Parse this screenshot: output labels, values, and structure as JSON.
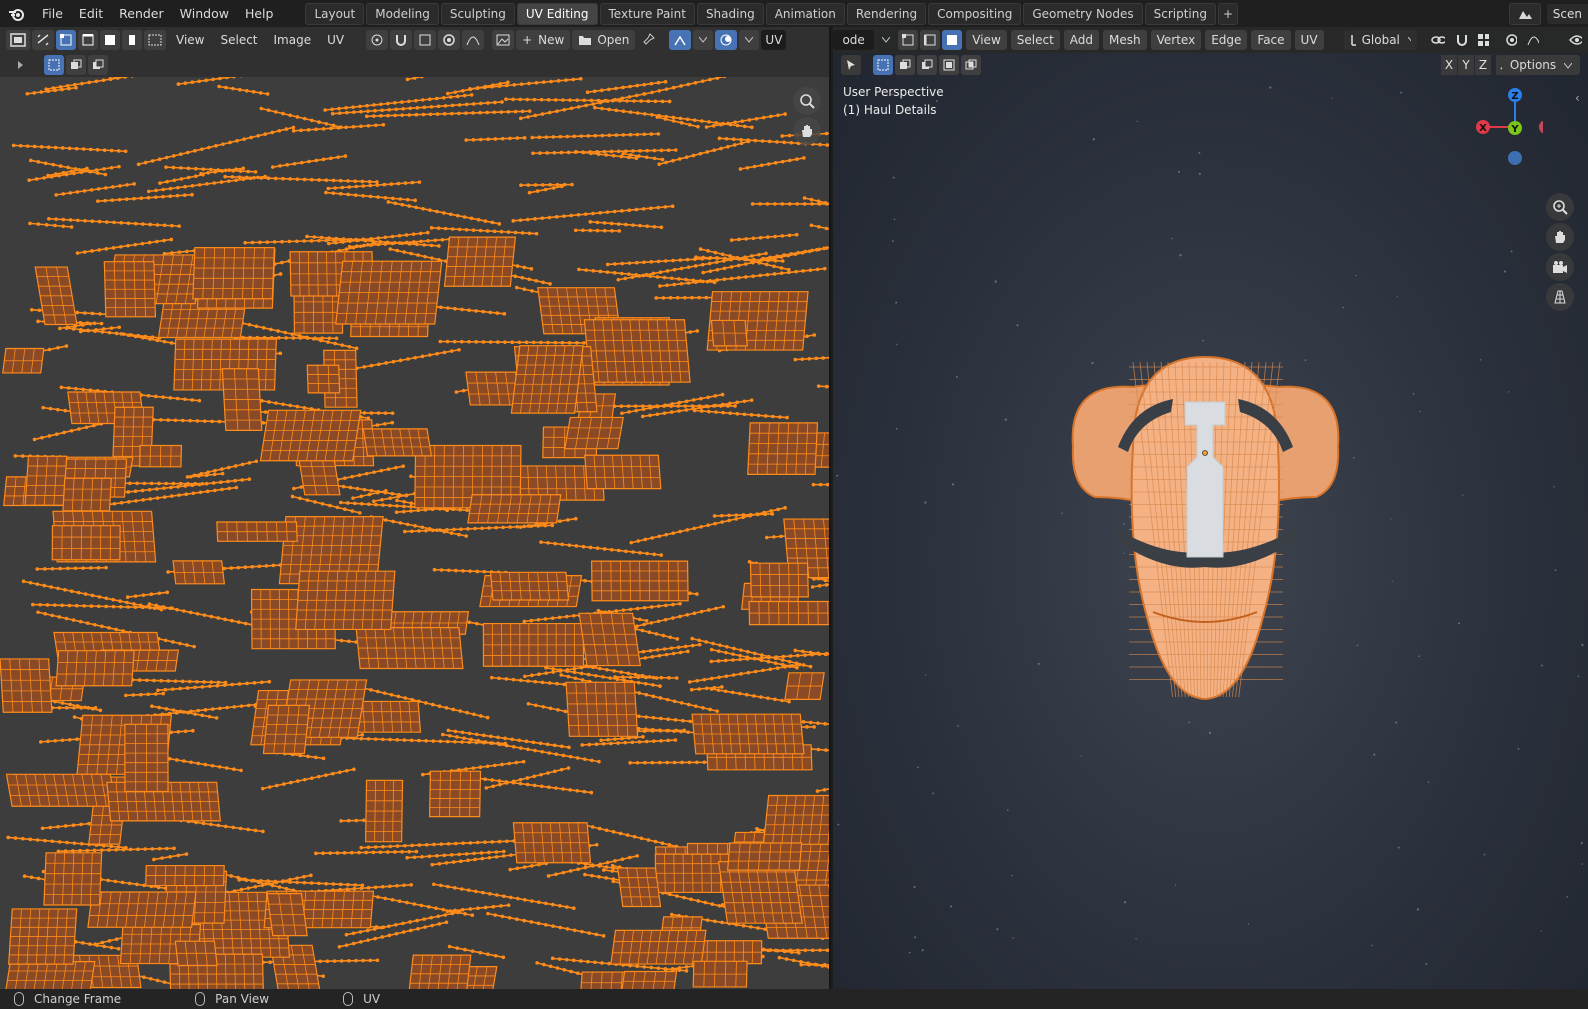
{
  "topbar": {
    "menus": [
      "File",
      "Edit",
      "Render",
      "Window",
      "Help"
    ],
    "workspaces": [
      "Layout",
      "Modeling",
      "Sculpting",
      "UV Editing",
      "Texture Paint",
      "Shading",
      "Animation",
      "Rendering",
      "Compositing",
      "Geometry Nodes",
      "Scripting"
    ],
    "active_workspace": "UV Editing",
    "add_tab": "+",
    "scene_label": "Scen"
  },
  "uv_editor": {
    "menus": [
      "View",
      "Select",
      "Image",
      "UV"
    ],
    "new_label": "New",
    "open_label": "Open",
    "mode_label": "UV"
  },
  "viewport": {
    "mode_label": "ode",
    "menus": [
      "View",
      "Select",
      "Add",
      "Mesh",
      "Vertex",
      "Edge",
      "Face",
      "UV"
    ],
    "orientation": "Global",
    "perspective_text": "User Perspective",
    "object_text": "(1) Haul Details",
    "axes": [
      "X",
      "Y",
      "Z"
    ],
    "options_label": "Options",
    "gizmo_labels": {
      "x": "X",
      "y": "Y",
      "z": "Z"
    }
  },
  "statusbar": {
    "items": [
      "Change Frame",
      "Pan View",
      "UV"
    ]
  },
  "colors": {
    "accent": "#4772b3",
    "uv_orange": "#ff8c1a",
    "uv_fill": "#8b4a26",
    "mesh_orange": "#f3b184",
    "x_axis": "#e0394a",
    "y_axis": "#7ac51c",
    "z_axis": "#2c7ee8"
  }
}
